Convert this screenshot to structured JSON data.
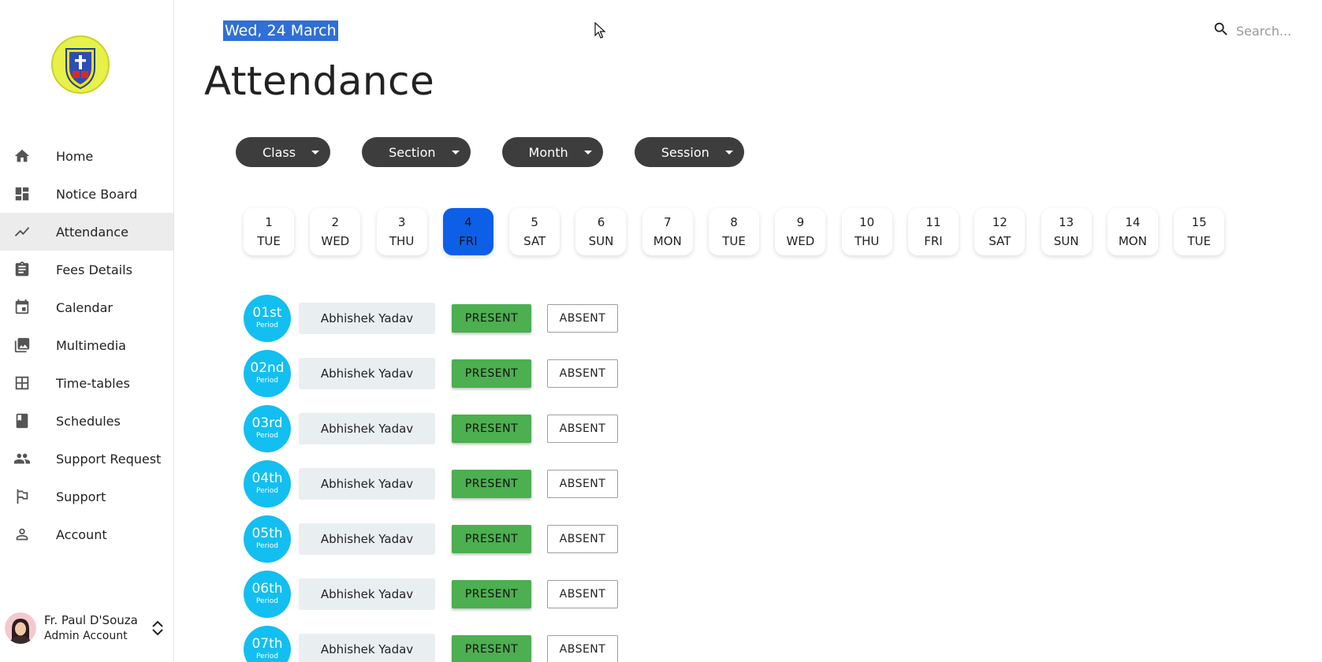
{
  "sidebar": {
    "items": [
      {
        "label": "Home",
        "icon": "home-icon"
      },
      {
        "label": "Notice Board",
        "icon": "dashboard-icon"
      },
      {
        "label": "Attendance",
        "icon": "trending-icon"
      },
      {
        "label": "Fees Details",
        "icon": "clipboard-icon"
      },
      {
        "label": "Calendar",
        "icon": "calendar-icon"
      },
      {
        "label": "Multimedia",
        "icon": "photo-library-icon"
      },
      {
        "label": "Time-tables",
        "icon": "grid-icon"
      },
      {
        "label": "Schedules",
        "icon": "book-icon"
      },
      {
        "label": "Support Request",
        "icon": "people-icon"
      },
      {
        "label": "Support",
        "icon": "flag-icon"
      },
      {
        "label": "Account",
        "icon": "person-icon"
      }
    ],
    "active_item": "Attendance",
    "user": {
      "name": "Fr. Paul D'Souza",
      "role": "Admin Account"
    }
  },
  "header": {
    "date": "Wed, 24 March",
    "title": "Attendance",
    "search_placeholder": "Search..."
  },
  "filters": [
    {
      "label": "Class"
    },
    {
      "label": "Section"
    },
    {
      "label": "Month"
    },
    {
      "label": "Session"
    }
  ],
  "days": [
    {
      "num": "1",
      "day": "TUE"
    },
    {
      "num": "2",
      "day": "WED"
    },
    {
      "num": "3",
      "day": "THU"
    },
    {
      "num": "4",
      "day": "FRI"
    },
    {
      "num": "5",
      "day": "SAT"
    },
    {
      "num": "6",
      "day": "SUN"
    },
    {
      "num": "7",
      "day": "MON"
    },
    {
      "num": "8",
      "day": "TUE"
    },
    {
      "num": "9",
      "day": "WED"
    },
    {
      "num": "10",
      "day": "THU"
    },
    {
      "num": "11",
      "day": "FRI"
    },
    {
      "num": "12",
      "day": "SAT"
    },
    {
      "num": "13",
      "day": "SUN"
    },
    {
      "num": "14",
      "day": "MON"
    },
    {
      "num": "15",
      "day": "TUE"
    }
  ],
  "selected_day": "4",
  "periods": [
    {
      "num": "01st",
      "sub": "Period",
      "student": "Abhishek Yadav",
      "present": "PRESENT",
      "absent": "ABSENT"
    },
    {
      "num": "02nd",
      "sub": "Period",
      "student": "Abhishek Yadav",
      "present": "PRESENT",
      "absent": "ABSENT"
    },
    {
      "num": "03rd",
      "sub": "Period",
      "student": "Abhishek Yadav",
      "present": "PRESENT",
      "absent": "ABSENT"
    },
    {
      "num": "04th",
      "sub": "Period",
      "student": "Abhishek Yadav",
      "present": "PRESENT",
      "absent": "ABSENT"
    },
    {
      "num": "05th",
      "sub": "Period",
      "student": "Abhishek Yadav",
      "present": "PRESENT",
      "absent": "ABSENT"
    },
    {
      "num": "06th",
      "sub": "Period",
      "student": "Abhishek Yadav",
      "present": "PRESENT",
      "absent": "ABSENT"
    },
    {
      "num": "07th",
      "sub": "Period",
      "student": "Abhishek Yadav",
      "present": "PRESENT",
      "absent": "ABSENT"
    }
  ],
  "colors": {
    "accent_blue": "#0d5fe8",
    "period_badge": "#12bff0",
    "present_green": "#4caf50",
    "filter_dark": "#3d3d3d",
    "date_highlight": "#2f6fd6"
  }
}
